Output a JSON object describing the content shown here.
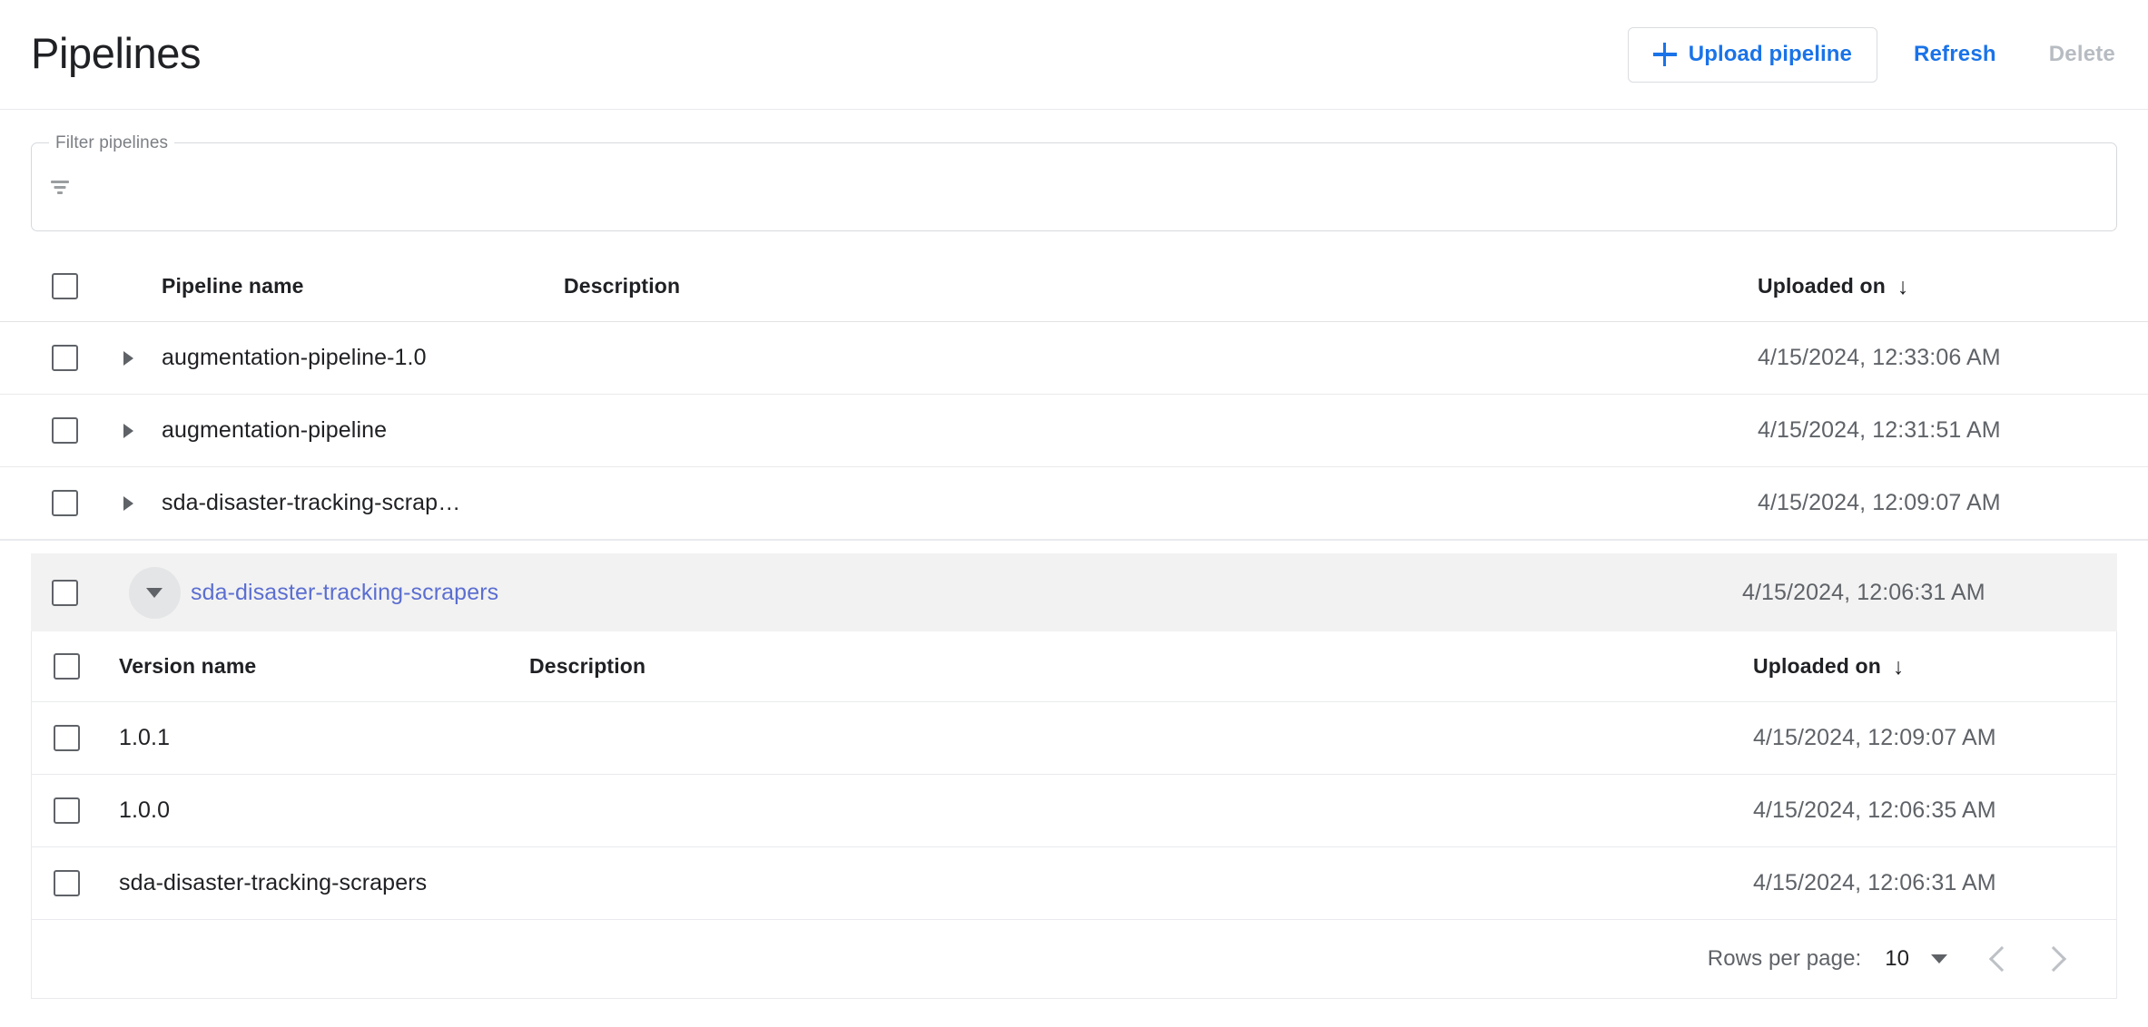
{
  "header": {
    "title": "Pipelines",
    "upload_label": "Upload pipeline",
    "refresh_label": "Refresh",
    "delete_label": "Delete",
    "accent_color": "#1a73e8",
    "disabled_color": "#b7bcc2"
  },
  "filter": {
    "label": "Filter pipelines",
    "value": "",
    "placeholder": "",
    "icon": "filter-list-icon"
  },
  "table": {
    "columns": {
      "name": "Pipeline name",
      "description": "Description",
      "uploaded_on": "Uploaded on",
      "sort_arrow": "↓"
    },
    "rows": [
      {
        "name": "augmentation-pipeline-1.0",
        "description": "",
        "uploaded_on": "4/15/2024, 12:33:06 AM",
        "expanded": false
      },
      {
        "name": "augmentation-pipeline",
        "description": "",
        "uploaded_on": "4/15/2024, 12:31:51 AM",
        "expanded": false
      },
      {
        "name": "sda-disaster-tracking-scrap…",
        "description": "",
        "uploaded_on": "4/15/2024, 12:09:07 AM",
        "expanded": false
      }
    ]
  },
  "expanded_group": {
    "name": "sda-disaster-tracking-scrapers",
    "description": "",
    "uploaded_on": "4/15/2024, 12:06:31 AM",
    "link_color": "#5b6ed1",
    "columns": {
      "name": "Version name",
      "description": "Description",
      "uploaded_on": "Uploaded on",
      "sort_arrow": "↓"
    },
    "versions": [
      {
        "name": "1.0.1",
        "description": "",
        "uploaded_on": "4/15/2024, 12:09:07 AM"
      },
      {
        "name": "1.0.0",
        "description": "",
        "uploaded_on": "4/15/2024, 12:06:35 AM"
      },
      {
        "name": "sda-disaster-tracking-scrapers",
        "description": "",
        "uploaded_on": "4/15/2024, 12:06:31 AM"
      }
    ]
  },
  "paginator": {
    "rows_per_page_label": "Rows per page:",
    "rows_per_page_value": "10",
    "prev_icon": "chevron-left-icon",
    "next_icon": "chevron-right-icon"
  }
}
